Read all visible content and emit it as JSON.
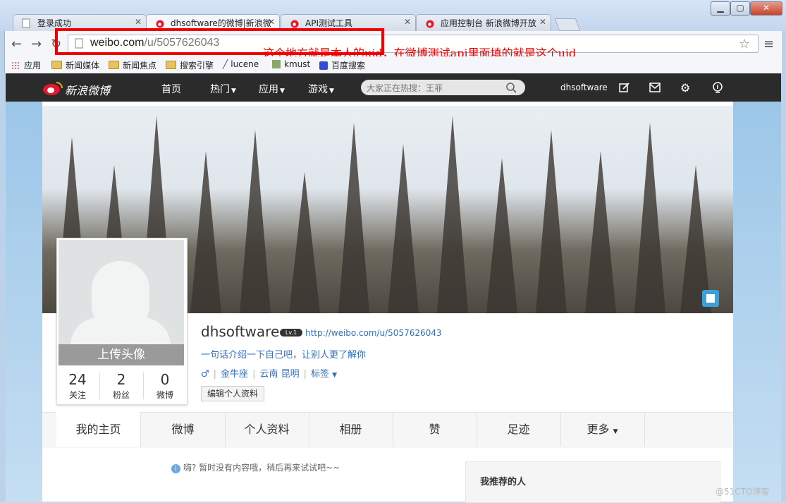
{
  "browser": {
    "tabs": [
      {
        "title": "登录成功"
      },
      {
        "title": "dhsoftware的微博|新浪微"
      },
      {
        "title": "API测试工具"
      },
      {
        "title": "应用控制台 新浪微博开放"
      }
    ],
    "url_host": "weibo.com",
    "url_path": "/u/5057626043",
    "annotation": "这个地方就是本人的uid，在微博测试api里面填的就是这个uid",
    "bookmarks": [
      "应用",
      "新闻媒体",
      "新闻焦点",
      "搜索引擎",
      "lucene",
      "kmust",
      "百度搜索"
    ]
  },
  "weibo_nav": {
    "logo": "新浪微博",
    "items": [
      "首页",
      "热门",
      "应用",
      "游戏"
    ],
    "search_placeholder": "大家正在热搜：王菲",
    "username": "dhsoftware"
  },
  "profile": {
    "upload_avatar": "上传头像",
    "stats": [
      {
        "num": "24",
        "label": "关注"
      },
      {
        "num": "2",
        "label": "粉丝"
      },
      {
        "num": "0",
        "label": "微博"
      }
    ],
    "name": "dhsoftware",
    "level": "Lv.1",
    "link": "http://weibo.com/u/5057626043",
    "intro": "一句话介绍一下自己吧，让别人更了解你",
    "gender_icon": "♂",
    "constellation": "金牛座",
    "location": "云南 昆明",
    "tags": "标签",
    "edit_button": "编辑个人资料"
  },
  "profile_tabs": [
    "我的主页",
    "微博",
    "个人资料",
    "相册",
    "赞",
    "足迹",
    "更多"
  ],
  "feed": {
    "empty_text": "嗨? 暂时没有内容哦，稍后再来试试吧~~",
    "recommend_title": "我推荐的人"
  },
  "watermark": "@51CTO博客"
}
